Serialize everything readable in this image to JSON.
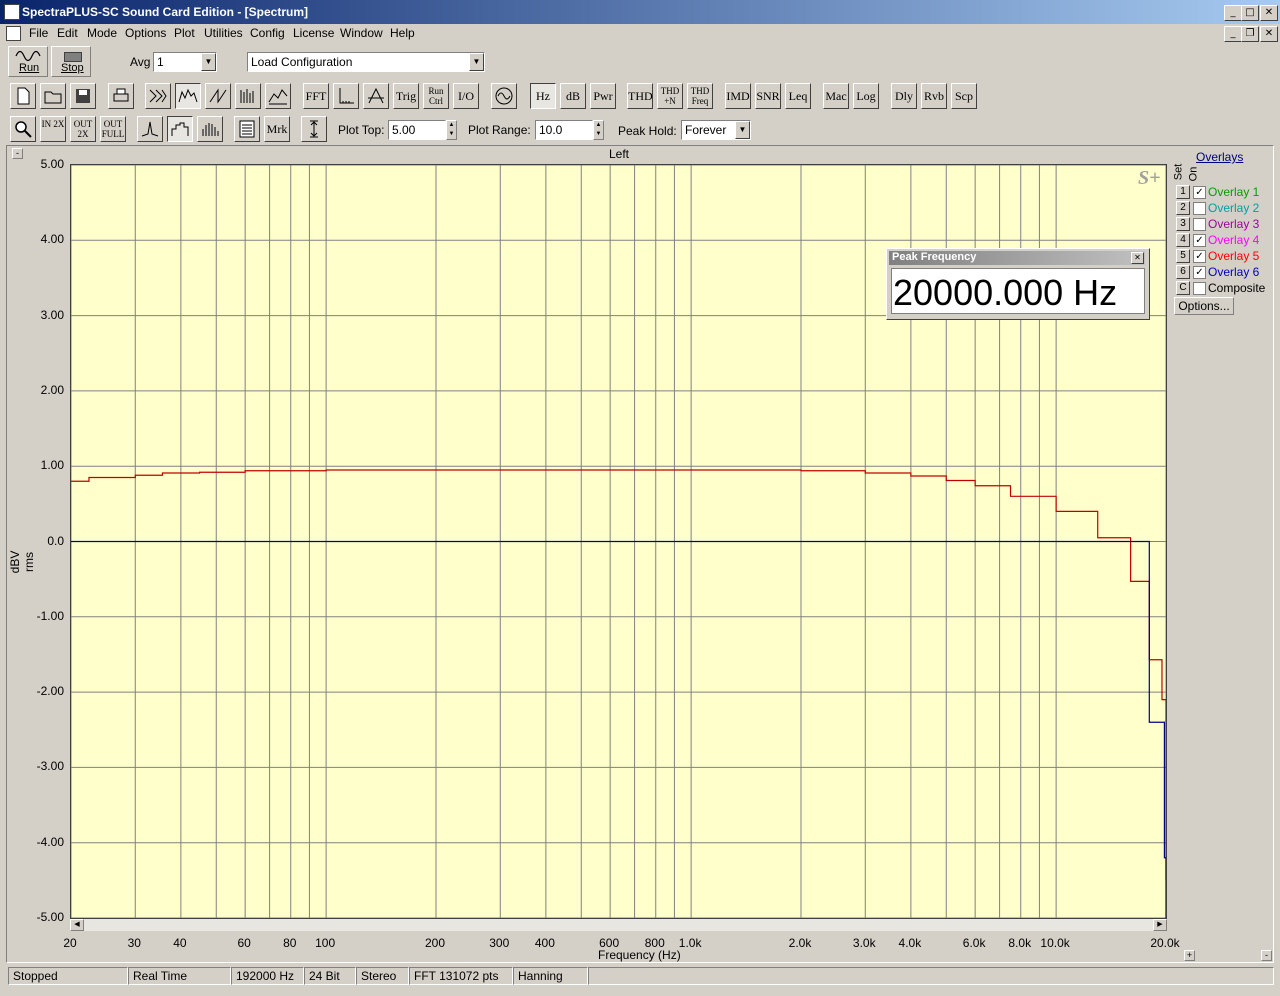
{
  "window": {
    "title": "SpectraPLUS-SC Sound Card Edition - [Spectrum]"
  },
  "menu": [
    "File",
    "Edit",
    "Mode",
    "Options",
    "Plot",
    "Utilities",
    "Config",
    "License",
    "Window",
    "Help"
  ],
  "toolbar1": {
    "run_label": "Run",
    "stop_label": "Stop",
    "avg_label": "Avg",
    "avg_value": "1",
    "config_value": "Load Configuration"
  },
  "toolbar2": {
    "fft": "FFT",
    "trig": "Trig",
    "run_ctrl": "Run Ctrl",
    "io": "I/O",
    "hz": "Hz",
    "db": "dB",
    "pwr": "Pwr",
    "thd": "THD",
    "thd_n": "THD +N",
    "thd_freq": "THD Freq",
    "imd": "IMD",
    "snr": "SNR",
    "leq": "Leq",
    "mac": "Mac",
    "log": "Log",
    "dly": "Dly",
    "rvb": "Rvb",
    "scp": "Scp"
  },
  "toolbar3": {
    "in_2x": "IN 2X",
    "out_2x": "OUT 2X",
    "out_full": "OUT FULL",
    "mrk": "Mrk",
    "plot_top_label": "Plot Top:",
    "plot_top_value": "5.00",
    "plot_range_label": "Plot Range:",
    "plot_range_value": "10.0",
    "peak_hold_label": "Peak Hold:",
    "peak_hold_value": "Forever"
  },
  "chart_data": {
    "type": "line",
    "title": "Left",
    "xlabel": "Frequency (Hz)",
    "ylabel": "dBV rms",
    "x_scale": "log",
    "xlim": [
      20,
      20000
    ],
    "ylim": [
      -5.0,
      5.0
    ],
    "grid": true,
    "x_ticks": [
      "20",
      "30",
      "40",
      "60",
      "80",
      "100",
      "200",
      "300",
      "400",
      "600",
      "800",
      "1.0k",
      "2.0k",
      "3.0k",
      "4.0k",
      "6.0k",
      "8.0k",
      "10.0k",
      "20.0k"
    ],
    "x_tick_values": [
      20,
      30,
      40,
      60,
      80,
      100,
      200,
      300,
      400,
      600,
      800,
      1000,
      2000,
      3000,
      4000,
      6000,
      8000,
      10000,
      20000
    ],
    "y_ticks": [
      "5.00",
      "4.00",
      "3.00",
      "2.00",
      "1.00",
      "0.0",
      "-1.00",
      "-2.00",
      "-3.00",
      "-4.00",
      "-5.00"
    ],
    "y_tick_values": [
      5,
      4,
      3,
      2,
      1,
      0,
      -1,
      -2,
      -3,
      -4,
      -5
    ],
    "series": [
      {
        "color": "#c00000",
        "step": true,
        "points": [
          [
            20,
            0.8
          ],
          [
            22.4,
            0.85
          ],
          [
            30,
            0.88
          ],
          [
            35.6,
            0.91
          ],
          [
            45,
            0.92
          ],
          [
            60,
            0.94
          ],
          [
            100,
            0.95
          ],
          [
            1200,
            0.95
          ],
          [
            2000,
            0.94
          ],
          [
            3000,
            0.91
          ],
          [
            4000,
            0.87
          ],
          [
            5000,
            0.81
          ],
          [
            6000,
            0.74
          ],
          [
            7500,
            0.6
          ],
          [
            10000,
            0.4
          ],
          [
            13000,
            0.05
          ],
          [
            16000,
            -0.53
          ],
          [
            18000,
            -1.57
          ],
          [
            19500,
            -2.1
          ],
          [
            20000,
            -4.5
          ]
        ]
      },
      {
        "color": "#00008b",
        "step": true,
        "points": [
          [
            20,
            0.0
          ],
          [
            18000,
            0.0
          ],
          [
            18001,
            -2.4
          ],
          [
            19500,
            -2.4
          ],
          [
            19800,
            -4.2
          ],
          [
            20000,
            -5.0
          ]
        ]
      }
    ]
  },
  "overlays": {
    "title": "Overlays",
    "set_label": "Set",
    "on_label": "On",
    "items": [
      {
        "num": "1",
        "label": "Overlay 1",
        "color": "#00a000",
        "checked": true
      },
      {
        "num": "2",
        "label": "Overlay 2",
        "color": "#00a0a0",
        "checked": false
      },
      {
        "num": "3",
        "label": "Overlay 3",
        "color": "#a000a0",
        "checked": false
      },
      {
        "num": "4",
        "label": "Overlay 4",
        "color": "#ff00ff",
        "checked": true
      },
      {
        "num": "5",
        "label": "Overlay 5",
        "color": "#ff0000",
        "checked": true
      },
      {
        "num": "6",
        "label": "Overlay 6",
        "color": "#0000c0",
        "checked": true
      },
      {
        "num": "C",
        "label": "Composite",
        "color": "#000000",
        "checked": false
      }
    ],
    "options_label": "Options..."
  },
  "peak_window": {
    "title": "Peak Frequency",
    "value": "20000.000 Hz"
  },
  "status": [
    "Stopped",
    "Real Time",
    "192000 Hz",
    "24 Bit",
    "Stereo",
    "FFT 131072 pts",
    "Hanning"
  ]
}
